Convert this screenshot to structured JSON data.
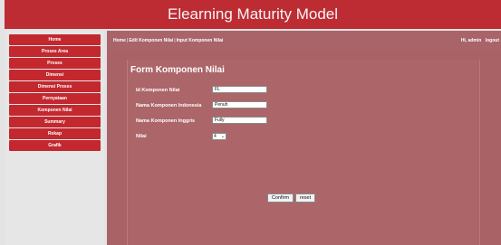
{
  "app": {
    "title": "Elearning Maturity Model"
  },
  "sidebar": {
    "items": [
      {
        "label": "Home"
      },
      {
        "label": "Proses Area"
      },
      {
        "label": "Proses"
      },
      {
        "label": "Dimensi"
      },
      {
        "label": "Dimensi Proses"
      },
      {
        "label": "Pernyataan"
      },
      {
        "label": "Komponen Nilai"
      },
      {
        "label": "Summary"
      },
      {
        "label": "Rekap"
      },
      {
        "label": "Grafik"
      }
    ]
  },
  "breadcrumb": {
    "items": [
      "Home",
      "Edit Komponen Nilai",
      "Input Komponen Nilai"
    ],
    "separator": "|"
  },
  "user": {
    "greeting": "Hi,",
    "name": "admin",
    "logout_label": "logout"
  },
  "form": {
    "title": "Form Komponen Nilai",
    "fields": [
      {
        "label": "Id Komponen Nilai",
        "value": "FL"
      },
      {
        "label": "Nama Komponen Indonesia",
        "value": "Penuh"
      },
      {
        "label": "Nama Komponen Inggris",
        "value": "Fully"
      }
    ],
    "nilai": {
      "label": "Nilai",
      "selected": "4"
    },
    "confirm_label": "Confirm",
    "reset_label": "reset"
  },
  "colors": {
    "header": "#bd2b33",
    "menu_item": "#c3282f",
    "content": "#a96266",
    "sidebar": "#e6e6e6"
  }
}
